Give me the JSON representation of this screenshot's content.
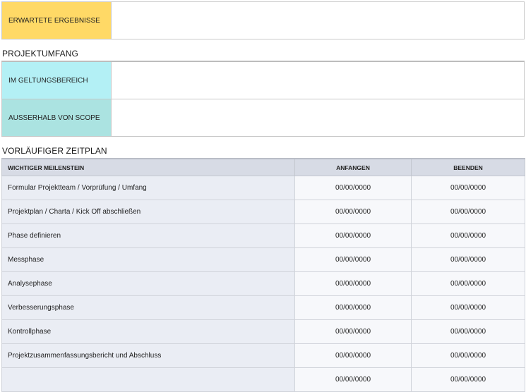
{
  "expected_results": {
    "label": "ERWARTETE ERGEBNISSE",
    "value": "",
    "color": "#ffd966"
  },
  "scope": {
    "title": "PROJEKTUMFANG",
    "in_scope": {
      "label": "IM GELTUNGSBEREICH",
      "value": "",
      "color": "#b3f0f5"
    },
    "out_of_scope": {
      "label": "AUSSERHALB VON SCOPE",
      "value": "",
      "color": "#abe3e1"
    }
  },
  "schedule": {
    "title": "VORLÄUFIGER ZEITPLAN",
    "headers": {
      "milestone": "WICHTIGER MEILENSTEIN",
      "start": "ANFANGEN",
      "end": "BEENDEN"
    },
    "rows": [
      {
        "milestone": "Formular Projektteam / Vorprüfung / Umfang",
        "start": "00/00/0000",
        "end": "00/00/0000"
      },
      {
        "milestone": "Projektplan / Charta / Kick Off abschließen",
        "start": "00/00/0000",
        "end": "00/00/0000"
      },
      {
        "milestone": "Phase definieren",
        "start": "00/00/0000",
        "end": "00/00/0000"
      },
      {
        "milestone": "Messphase",
        "start": "00/00/0000",
        "end": "00/00/0000"
      },
      {
        "milestone": "Analysephase",
        "start": "00/00/0000",
        "end": "00/00/0000"
      },
      {
        "milestone": "Verbesserungsphase",
        "start": "00/00/0000",
        "end": "00/00/0000"
      },
      {
        "milestone": "Kontrollphase",
        "start": "00/00/0000",
        "end": "00/00/0000"
      },
      {
        "milestone": "Projektzusammenfassungsbericht und Abschluss",
        "start": "00/00/0000",
        "end": "00/00/0000"
      },
      {
        "milestone": "",
        "start": "00/00/0000",
        "end": "00/00/0000"
      }
    ]
  }
}
